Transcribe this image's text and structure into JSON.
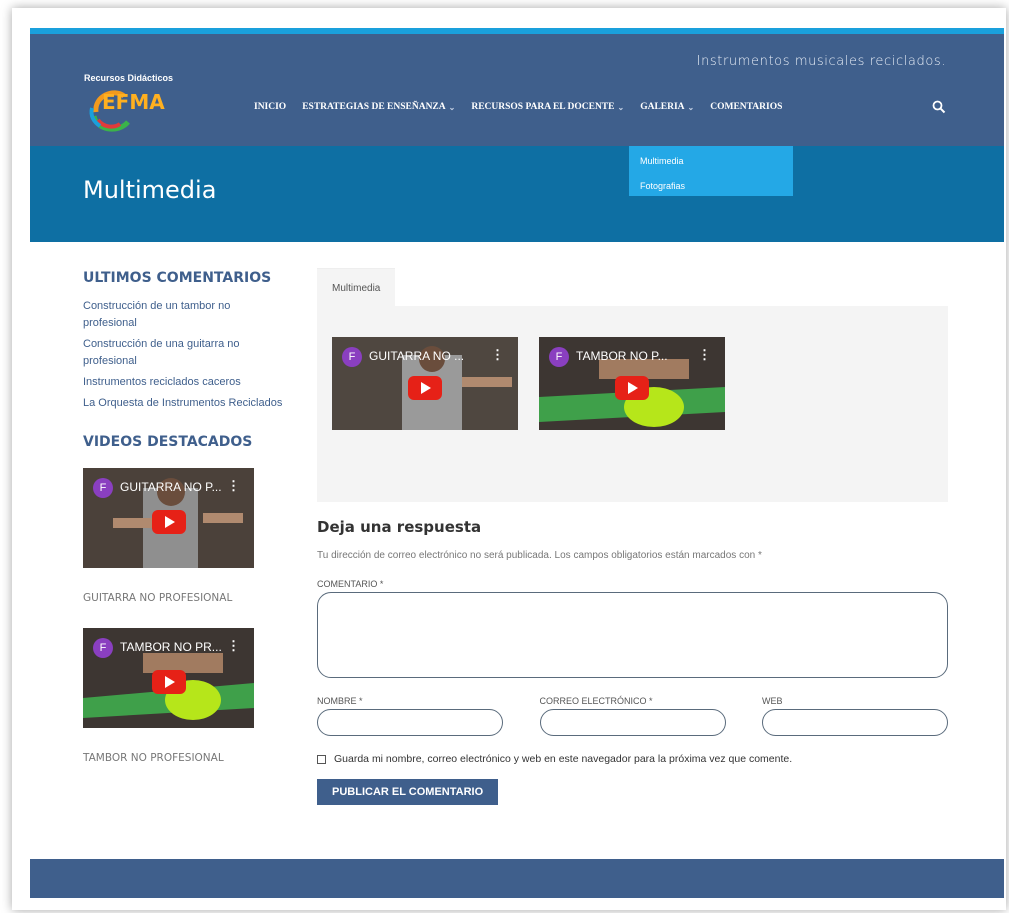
{
  "header": {
    "tagline": "Instrumentos musicales reciclados.",
    "logo_small": "Recursos Didácticos",
    "logo_text": "EFMA",
    "nav": [
      {
        "label": "INICIO",
        "dropdown": false
      },
      {
        "label": "ESTRATEGIAS DE ENSEÑANZA",
        "dropdown": true
      },
      {
        "label": "RECURSOS PARA EL DOCENTE",
        "dropdown": true
      },
      {
        "label": "GALERIA",
        "dropdown": true
      },
      {
        "label": "COMENTARIOS",
        "dropdown": false
      }
    ],
    "search_icon": "search-icon"
  },
  "dropdown": {
    "items": [
      "Multimedia",
      "Fotografias"
    ]
  },
  "banner": {
    "title": "Multimedia"
  },
  "sidebar": {
    "comments_heading": "ULTIMOS COMENTARIOS",
    "comments": [
      "Construcción de un tambor no profesional",
      "Construcción de una guitarra no profesional",
      "Instrumentos reciclados caceros",
      "La Orquesta de Instrumentos Reciclados"
    ],
    "videos_heading": "VIDEOS DESTACADOS",
    "videos": [
      {
        "title": "GUITARRA NO P...",
        "channel": "F",
        "caption": "GUITARRA NO PROFESIONAL"
      },
      {
        "title": "TAMBOR NO PR...",
        "channel": "F",
        "caption": "TAMBOR NO PROFESIONAL"
      }
    ]
  },
  "main": {
    "tab_label": "Multimedia",
    "videos": [
      {
        "title": "GUITARRA NO ...",
        "channel": "F"
      },
      {
        "title": "TAMBOR NO P...",
        "channel": "F"
      }
    ]
  },
  "reply": {
    "title": "Deja una respuesta",
    "note": "Tu dirección de correo electrónico no será publicada. Los campos obligatorios están marcados con *",
    "comment_label": "COMENTARIO *",
    "name_label": "NOMBRE *",
    "email_label": "CORREO ELECTRÓNICO *",
    "web_label": "WEB",
    "save_label": "Guarda mi nombre, correo electrónico y web en este navegador para la próxima vez que comente.",
    "submit_label": "PUBLICAR EL COMENTARIO"
  },
  "colors": {
    "header": "#3f5f8c",
    "banner": "#0e6fa3",
    "accent": "#1aa0dc",
    "dropdown": "#24a8e6"
  }
}
